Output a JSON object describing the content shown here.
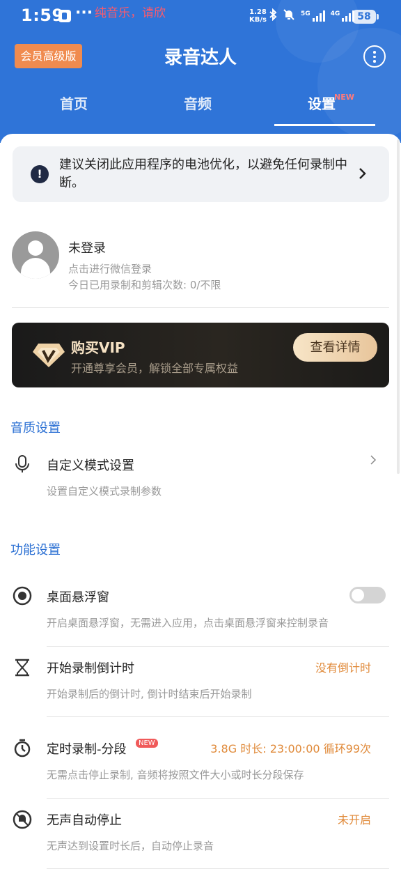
{
  "status_bar": {
    "time": "1:59",
    "more": "···",
    "notification": "纯音乐，请欣",
    "net_speed": "1.28",
    "net_speed_unit": "KB/s",
    "signal1_label": "5G",
    "signal2_label": "4G",
    "battery": "58"
  },
  "header": {
    "vip_badge": "会员高级版",
    "title": "录音达人",
    "tabs": [
      {
        "label": "首页"
      },
      {
        "label": "音频"
      },
      {
        "label": "设置"
      }
    ],
    "tab_new_badge": "NEW"
  },
  "battery_tip": {
    "icon": "exclamation-icon",
    "text": "建议关闭此应用程序的电池优化，以避免任何录制中断。"
  },
  "user": {
    "name": "未登录",
    "login_hint": "点击进行微信登录",
    "usage": "今日已用录制和剪辑次数: 0/不限"
  },
  "vip_card": {
    "title": "购买VIP",
    "subtitle": "开通尊享会员，解锁全部专属权益",
    "button": "查看详情"
  },
  "sections": {
    "quality": {
      "title": "音质设置",
      "custom_mode": {
        "title": "自定义模式设置",
        "desc": "设置自定义模式录制参数"
      }
    },
    "features": {
      "title": "功能设置",
      "floating_window": {
        "title": "桌面悬浮窗",
        "desc": "开启桌面悬浮窗，无需进入应用，点击桌面悬浮窗来控制录音",
        "enabled": false
      },
      "countdown": {
        "title": "开始录制倒计时",
        "value": "没有倒计时",
        "desc": "开始录制后的倒计时, 倒计时结束后开始录制"
      },
      "timed_split": {
        "title": "定时录制-分段",
        "new_badge": "NEW",
        "value": "3.8G 时长: 23:00:00 循环99次",
        "desc": "无需点击停止录制, 音频将按照文件大小或时长分段保存"
      },
      "silence_stop": {
        "title": "无声自动停止",
        "value": "未开启",
        "desc": "无声达到设置时长后，自动停止录音"
      }
    }
  },
  "colors": {
    "header_blue": "#2f74d8",
    "accent_orange": "#e08a3a",
    "section_blue": "#2a6fd3",
    "vip_badge": "#f08b4f"
  }
}
